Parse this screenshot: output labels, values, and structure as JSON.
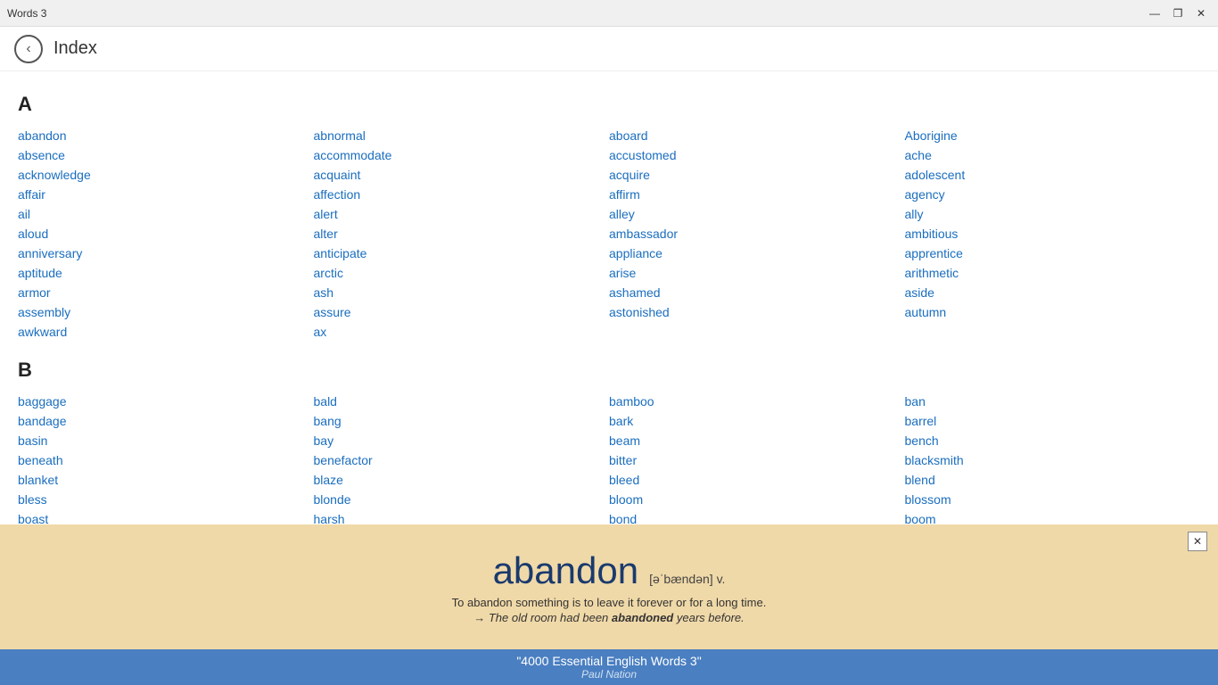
{
  "titlebar": {
    "title": "Words 3",
    "minimize_label": "—",
    "maximize_label": "❐",
    "close_label": "✕"
  },
  "navbar": {
    "back_icon": "‹",
    "title": "Index"
  },
  "sections": [
    {
      "letter": "A",
      "words": [
        "abandon",
        "abnormal",
        "aboard",
        "Aborigine",
        "absence",
        "accommodate",
        "accustomed",
        "ache",
        "acknowledge",
        "acquaint",
        "acquire",
        "adolescent",
        "affair",
        "affection",
        "affirm",
        "agency",
        "ail",
        "alert",
        "alley",
        "ally",
        "aloud",
        "alter",
        "ambassador",
        "ambitious",
        "anniversary",
        "anticipate",
        "appliance",
        "apprentice",
        "aptitude",
        "arctic",
        "arise",
        "arithmetic",
        "armor",
        "ash",
        "ashamed",
        "aside",
        "assembly",
        "assure",
        "astonished",
        "autumn",
        "awkward",
        "ax",
        "",
        ""
      ]
    },
    {
      "letter": "B",
      "words": [
        "baggage",
        "bald",
        "bamboo",
        "ban",
        "bandage",
        "bang",
        "bark",
        "barrel",
        "basin",
        "bay",
        "beam",
        "bench",
        "beneath",
        "benefactor",
        "bitter",
        "blacksmith",
        "blanket",
        "blaze",
        "bleed",
        "blend",
        "bless",
        "blonde",
        "bloom",
        "blossom",
        "boast",
        "harsh",
        "bond",
        "boom"
      ]
    }
  ],
  "definition": {
    "word": "abandon",
    "pronunciation": "[əˈbændən] v.",
    "meaning": "To abandon something is to leave it forever or for a long time.",
    "example_prefix": "→",
    "example_text": "The old room had been ",
    "example_bold": "abandoned",
    "example_suffix": " years before.",
    "close_label": "✕"
  },
  "footer": {
    "title": "\"4000 Essential English Words 3\"",
    "author": "Paul Nation"
  }
}
